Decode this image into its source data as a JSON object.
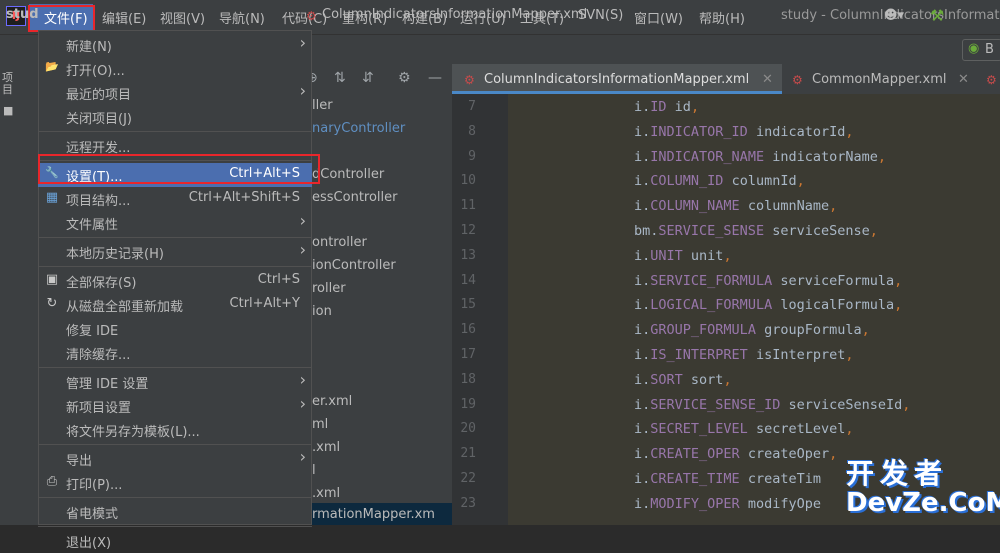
{
  "menubar": {
    "logo": "IJ",
    "items": [
      "文件(F)",
      "编辑(E)",
      "视图(V)",
      "导航(N)",
      "代码(C)",
      "重构(R)",
      "构建(B)",
      "运行(U)",
      "工具(T)",
      "SVN(S)",
      "窗口(W)",
      "帮助(H)"
    ],
    "window_title": "study - ColumnIndicatorsInformat"
  },
  "navbar": {
    "project": "stud",
    "file": "ColumnIndicatorsInformationMapper.xml",
    "run_config": "B"
  },
  "toolstrip": {
    "project_label": "项目"
  },
  "project_tree": {
    "items": [
      "ller",
      "naryController",
      "dController",
      "essController",
      "ontroller",
      "ionController",
      "roller",
      "ion",
      "er.xml",
      "ml",
      ".xml",
      "l",
      ".xml",
      "rmationMapper.xm"
    ]
  },
  "tabs": [
    {
      "label": "ColumnIndicatorsInformationMapper.xml",
      "active": true
    },
    {
      "label": "CommonMapper.xml",
      "active": false
    }
  ],
  "editor": {
    "lines": [
      {
        "n": "7",
        "alias": "i",
        "field": "ID",
        "rest": " id",
        "comma": ","
      },
      {
        "n": "8",
        "alias": "i",
        "field": "INDICATOR_ID",
        "rest": " indicatorId",
        "comma": ","
      },
      {
        "n": "9",
        "alias": "i",
        "field": "INDICATOR_NAME",
        "rest": " indicatorName",
        "comma": ","
      },
      {
        "n": "10",
        "alias": "i",
        "field": "COLUMN_ID",
        "rest": " columnId",
        "comma": ","
      },
      {
        "n": "11",
        "alias": "i",
        "field": "COLUMN_NAME",
        "rest": " columnName",
        "comma": ","
      },
      {
        "n": "12",
        "alias": "bm",
        "field": "SERVICE_SENSE",
        "rest": " serviceSense",
        "comma": ","
      },
      {
        "n": "13",
        "alias": "i",
        "field": "UNIT",
        "rest": " unit",
        "comma": ","
      },
      {
        "n": "14",
        "alias": "i",
        "field": "SERVICE_FORMULA",
        "rest": " serviceFormula",
        "comma": ","
      },
      {
        "n": "15",
        "alias": "i",
        "field": "LOGICAL_FORMULA",
        "rest": " logicalFormula",
        "comma": ","
      },
      {
        "n": "16",
        "alias": "i",
        "field": "GROUP_FORMULA",
        "rest": " groupFormula",
        "comma": ","
      },
      {
        "n": "17",
        "alias": "i",
        "field": "IS_INTERPRET",
        "rest": " isInterpret",
        "comma": ","
      },
      {
        "n": "18",
        "alias": "i",
        "field": "SORT",
        "rest": " sort",
        "comma": ","
      },
      {
        "n": "19",
        "alias": "i",
        "field": "SERVICE_SENSE_ID",
        "rest": " serviceSenseId",
        "comma": ","
      },
      {
        "n": "20",
        "alias": "i",
        "field": "SECRET_LEVEL",
        "rest": " secretLevel",
        "comma": ","
      },
      {
        "n": "21",
        "alias": "i",
        "field": "CREATE_OPER",
        "rest": " createOper",
        "comma": ","
      },
      {
        "n": "22",
        "alias": "i",
        "field": "CREATE_TIME",
        "rest": " createTim",
        "comma": ""
      },
      {
        "n": "23",
        "alias": "i",
        "field": "MODIFY_OPER",
        "rest": " modifyOpe",
        "comma": ""
      }
    ]
  },
  "file_menu": {
    "items": [
      {
        "label": "新建(N)",
        "submenu": true
      },
      {
        "label": "打开(O)...",
        "icon": "folder-icon"
      },
      {
        "label": "最近的项目",
        "submenu": true
      },
      {
        "label": "关闭项目(J)"
      },
      {
        "sep": true
      },
      {
        "label": "远程开发..."
      },
      {
        "sep": true
      },
      {
        "label": "设置(T)...",
        "shortcut": "Ctrl+Alt+S",
        "icon": "wrench-icon",
        "selected": true
      },
      {
        "label": "项目结构...",
        "shortcut": "Ctrl+Alt+Shift+S",
        "icon": "project-structure-icon"
      },
      {
        "label": "文件属性",
        "submenu": true
      },
      {
        "sep": true
      },
      {
        "label": "本地历史记录(H)",
        "submenu": true
      },
      {
        "sep": true
      },
      {
        "label": "全部保存(S)",
        "shortcut": "Ctrl+S",
        "icon": "save-icon"
      },
      {
        "label": "从磁盘全部重新加载",
        "shortcut": "Ctrl+Alt+Y",
        "icon": "reload-icon"
      },
      {
        "label": "修复 IDE"
      },
      {
        "label": "清除缓存..."
      },
      {
        "sep": true
      },
      {
        "label": "管理 IDE 设置",
        "submenu": true
      },
      {
        "label": "新项目设置",
        "submenu": true
      },
      {
        "label": "将文件另存为模板(L)..."
      },
      {
        "sep": true
      },
      {
        "label": "导出",
        "submenu": true
      },
      {
        "label": "打印(P)...",
        "icon": "print-icon"
      },
      {
        "sep": true
      },
      {
        "label": "省电模式"
      },
      {
        "sep": true
      },
      {
        "label": "退出(X)"
      }
    ]
  },
  "watermark": {
    "cn": "开发者",
    "en": "DevZe.CoM"
  },
  "colors": {
    "accent": "#4b6eaf",
    "highlight_box": "#e8262b",
    "field": "#9876aa",
    "punct": "#cc7832"
  }
}
